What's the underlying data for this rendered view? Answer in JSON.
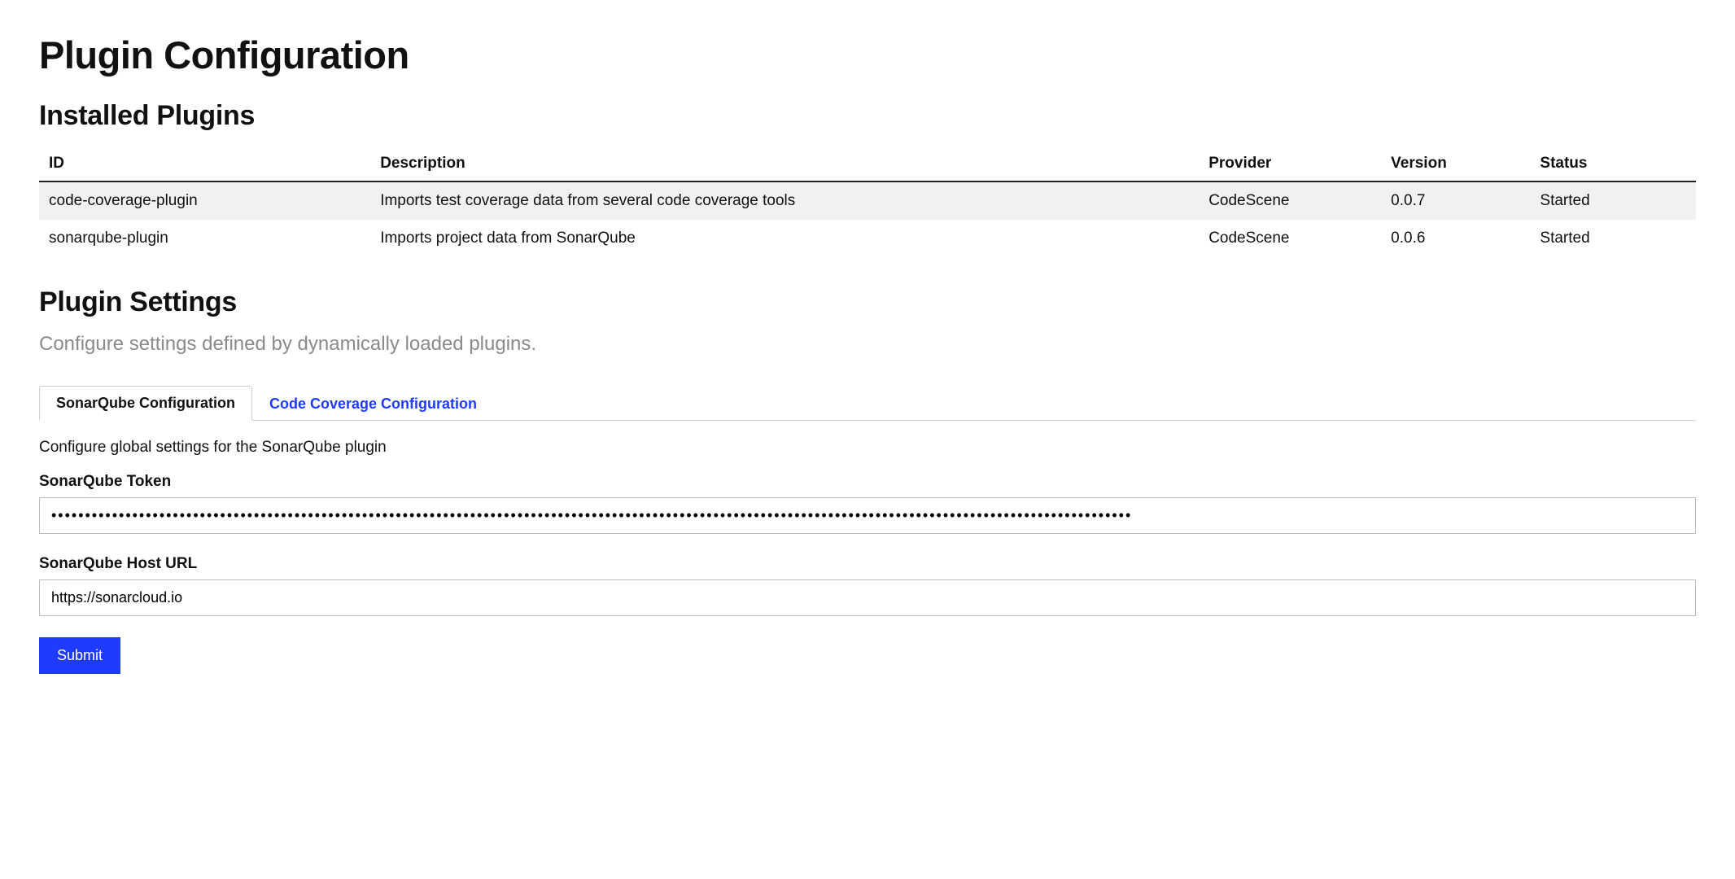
{
  "page_title": "Plugin Configuration",
  "installed": {
    "heading": "Installed Plugins",
    "columns": {
      "id": "ID",
      "description": "Description",
      "provider": "Provider",
      "version": "Version",
      "status": "Status"
    },
    "rows": [
      {
        "id": "code-coverage-plugin",
        "description": "Imports test coverage data from several code coverage tools",
        "provider": "CodeScene",
        "version": "0.0.7",
        "status": "Started"
      },
      {
        "id": "sonarqube-plugin",
        "description": "Imports project data from SonarQube",
        "provider": "CodeScene",
        "version": "0.0.6",
        "status": "Started"
      }
    ]
  },
  "settings": {
    "heading": "Plugin Settings",
    "description": "Configure settings defined by dynamically loaded plugins.",
    "tabs": [
      {
        "label": "SonarQube Configuration",
        "active": true
      },
      {
        "label": "Code Coverage Configuration",
        "active": false
      }
    ],
    "panel": {
      "description": "Configure global settings for the SonarQube plugin",
      "fields": {
        "token": {
          "label": "SonarQube Token",
          "value": "••••••••••••••••••••••••••••••••••••••••••••••••••••••••••••••••••••••••••••••••••••••••••••••••••••••••••••••••••••••••••••••••••••••••••••••••••••••••••••••••"
        },
        "host_url": {
          "label": "SonarQube Host URL",
          "value": "https://sonarcloud.io"
        }
      },
      "submit_label": "Submit"
    }
  }
}
